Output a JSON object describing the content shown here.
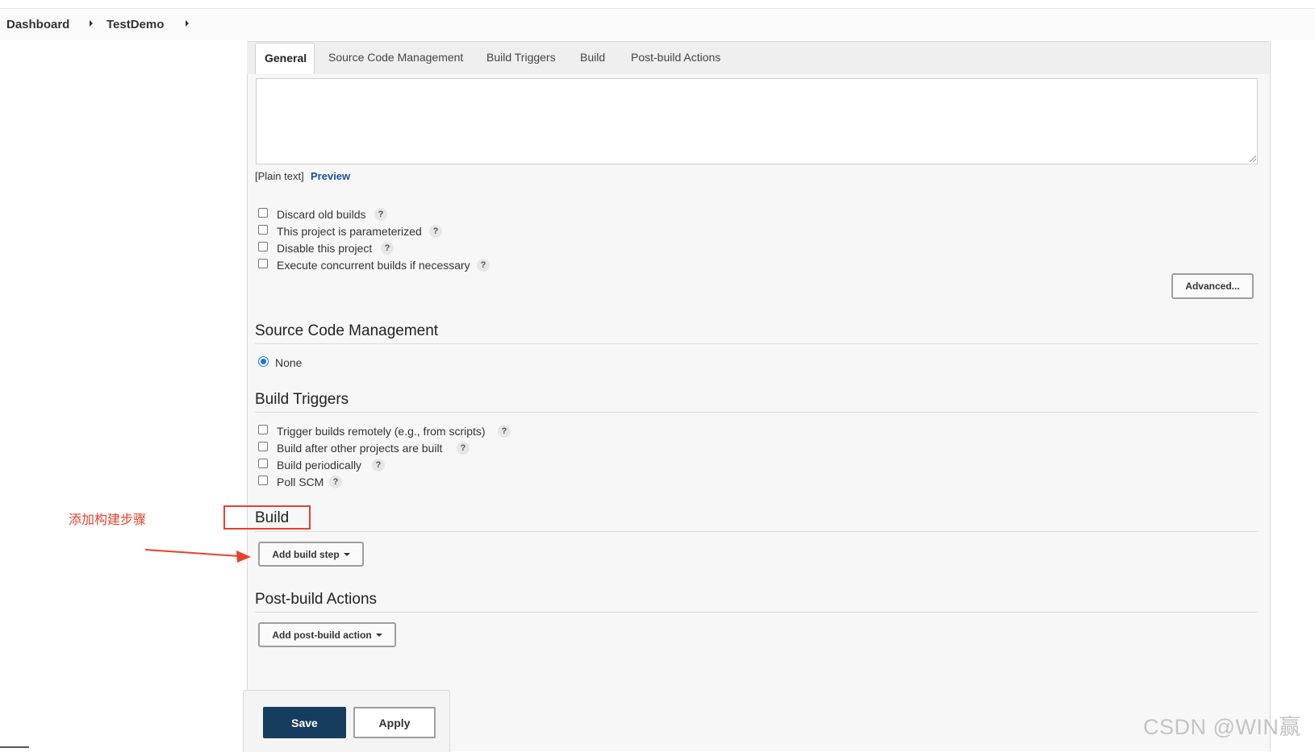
{
  "breadcrumb": {
    "items": [
      "Dashboard",
      "TestDemo"
    ]
  },
  "tabs": [
    "General",
    "Source Code Management",
    "Build Triggers",
    "Build",
    "Post-build Actions"
  ],
  "active_tab": "General",
  "general": {
    "format_text": "[Plain text]",
    "preview_link": "Preview",
    "options": [
      "Discard old builds",
      "This project is parameterized",
      "Disable this project",
      "Execute concurrent builds if necessary"
    ],
    "advanced_button": "Advanced..."
  },
  "scm": {
    "title": "Source Code Management",
    "selected_option": "None"
  },
  "triggers": {
    "title": "Build Triggers",
    "options": [
      "Trigger builds remotely (e.g., from scripts)",
      "Build after other projects are built",
      "Build periodically",
      "Poll SCM"
    ]
  },
  "build": {
    "title": "Build",
    "add_step_button": "Add build step"
  },
  "post_build": {
    "title": "Post-build Actions",
    "add_action_button": "Add post-build action"
  },
  "footer": {
    "save_label": "Save",
    "apply_label": "Apply"
  },
  "annotation": {
    "text": "添加构建步骤",
    "color": "#e8412c"
  },
  "help_glyph": "?",
  "watermark": "CSDN @WIN赢",
  "colors": {
    "save_button": "#163c5e",
    "link": "#1b4f9c",
    "radio": "#1a73e8"
  }
}
